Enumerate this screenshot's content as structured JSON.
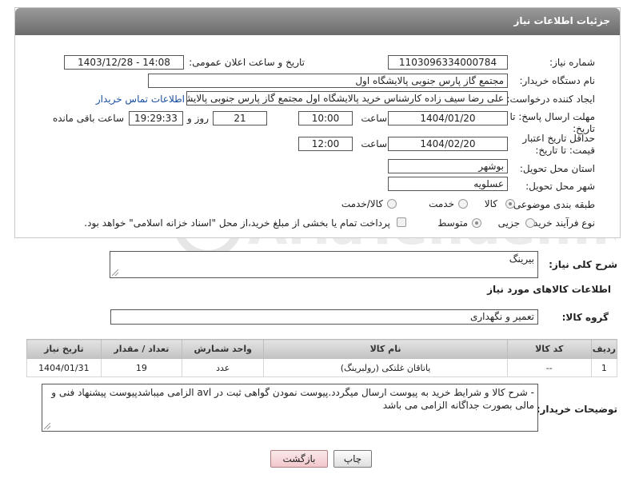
{
  "header": {
    "title": "جزئیات اطلاعات نیاز"
  },
  "form": {
    "need_number": {
      "label": "شماره نیاز:",
      "value": "1103096334000784"
    },
    "announce_datetime": {
      "label": "تاریخ و ساعت اعلان عمومی:",
      "value": "1403/12/28 - 14:08"
    },
    "buyer_org": {
      "label": "نام دستگاه خریدار:",
      "value": "مجتمع گاز پارس جنوبی  پالایشگاه اول"
    },
    "requester": {
      "label": "ایجاد کننده درخواست:",
      "value": "علی رضا سیف زاده کارشناس خرید پالایشگاه اول مجتمع گاز پارس جنوبی  پالایشگاه اول",
      "contact_link": "اطلاعات تماس خریدار"
    },
    "reply_deadline": {
      "label": "مهلت ارسال پاسخ: تا تاریخ:",
      "date": "1404/01/20",
      "time_label": "ساعت",
      "time": "10:00",
      "days": "21",
      "days_label": "روز و",
      "remaining": "19:29:33",
      "remaining_label": "ساعت باقی مانده"
    },
    "price_validity": {
      "label": "حداقل تاریخ اعتبار قیمت: تا تاریخ:",
      "date": "1404/02/20",
      "time_label": "ساعت",
      "time": "12:00"
    },
    "province": {
      "label": "استان محل تحویل:",
      "value": "بوشهر"
    },
    "city": {
      "label": "شهر محل تحویل:",
      "value": "عسلویه"
    },
    "category": {
      "label": "طبقه بندی موضوعی:",
      "options": [
        "کالا",
        "خدمت",
        "کالا/خدمت"
      ],
      "selected": "کالا"
    },
    "purchase_type": {
      "label": "نوع فرآیند خرید :",
      "options": [
        "جزیی",
        "متوسط"
      ],
      "selected": "متوسط",
      "payment_note": "پرداخت تمام یا بخشی از مبلغ خرید،از محل \"اسناد خزانه اسلامی\" خواهد بود."
    }
  },
  "summary": {
    "label": "شرح کلی نیاز:",
    "value": "بیرینگ"
  },
  "goods_section_title": "اطلاعات کالاهای مورد نیاز",
  "goods_group": {
    "label": "گروه کالا:",
    "value": "تعمیر و نگهداری"
  },
  "table": {
    "columns": [
      "ردیف",
      "کد کالا",
      "نام کالا",
      "واحد شمارش",
      "تعداد / مقدار",
      "تاریخ نیاز"
    ],
    "rows": [
      [
        "1",
        "--",
        "یاتاقان غلتکی (رولبرینگ)",
        "عدد",
        "19",
        "1404/01/31"
      ]
    ]
  },
  "buyer_notes": {
    "label": "توضیحات خریدار:",
    "value": "-  شرح کالا و شرایط خرید به پیوست ارسال میگردد.پیوست نمودن گواهی ثبت در avl الزامی میباشدپیوست پیشنهاد فنی و مالی بصورت جداگانه الزامی می باشد"
  },
  "buttons": {
    "print": "چاپ",
    "back": "بازگشت"
  },
  "watermark_text": "AriaTender.neT",
  "colors": {
    "header": "#7a7a7a",
    "link": "#1a4fa0",
    "back_button": "#f2c7cb"
  }
}
